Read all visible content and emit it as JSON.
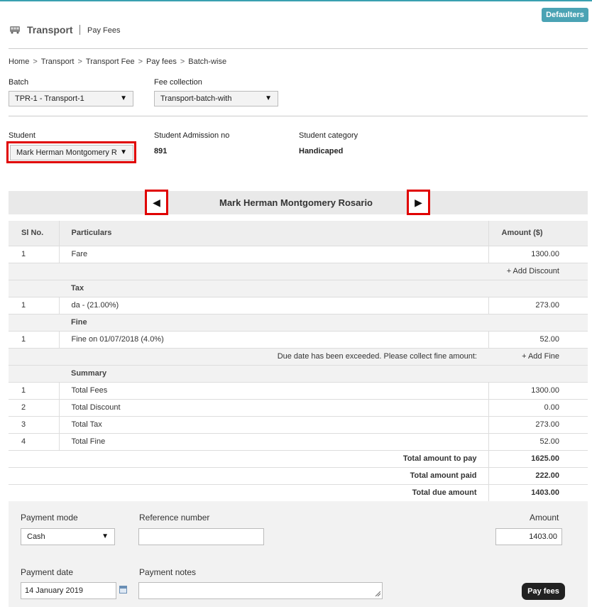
{
  "header": {
    "title": "Transport",
    "subtitle": "Pay Fees",
    "defaulters_label": "Defaulters",
    "icon": "bus-icon"
  },
  "breadcrumb": {
    "items": [
      "Home",
      "Transport",
      "Transport Fee",
      "Pay fees"
    ],
    "current": "Batch-wise",
    "separator": ">"
  },
  "filters": {
    "batch_label": "Batch",
    "batch_value": "TPR-1 - Transport-1",
    "fee_collection_label": "Fee collection",
    "fee_collection_value": "Transport-batch-with"
  },
  "student": {
    "student_label": "Student",
    "student_value": "Mark Herman Montgomery R",
    "admission_label": "Student Admission no",
    "admission_value": "891",
    "category_label": "Student category",
    "category_value": "Handicaped",
    "full_name": "Mark Herman Montgomery Rosario"
  },
  "table": {
    "headers": {
      "sl": "Sl No.",
      "particulars": "Particulars",
      "amount": "Amount ($)"
    },
    "fare_row": {
      "sl": "1",
      "particular": "Fare",
      "amount": "1300.00"
    },
    "add_discount": "+ Add Discount",
    "tax_section": "Tax",
    "tax_row": {
      "sl": "1",
      "particular": "da - (21.00%)",
      "amount": "273.00"
    },
    "fine_section": "Fine",
    "fine_row": {
      "sl": "1",
      "particular": "Fine on 01/07/2018 (4.0%)",
      "amount": "52.00"
    },
    "due_message": "Due date has been exceeded. Please collect fine amount:",
    "add_fine": "+ Add Fine",
    "summary_section": "Summary",
    "summary": [
      {
        "sl": "1",
        "label": "Total Fees",
        "amount": "1300.00"
      },
      {
        "sl": "2",
        "label": "Total Discount",
        "amount": "0.00"
      },
      {
        "sl": "3",
        "label": "Total Tax",
        "amount": "273.00"
      },
      {
        "sl": "4",
        "label": "Total Fine",
        "amount": "52.00"
      }
    ],
    "totals": [
      {
        "label": "Total amount to pay",
        "amount": "1625.00"
      },
      {
        "label": "Total amount paid",
        "amount": "222.00"
      },
      {
        "label": "Total due amount",
        "amount": "1403.00"
      }
    ]
  },
  "payment": {
    "mode_label": "Payment mode",
    "mode_value": "Cash",
    "reference_label": "Reference number",
    "reference_value": "",
    "amount_label": "Amount",
    "amount_value": "1403.00",
    "date_label": "Payment date",
    "date_value": "14 January 2019",
    "notes_label": "Payment notes",
    "notes_value": "",
    "pay_button": "Pay fees"
  },
  "colors": {
    "accent": "#4ba3b4",
    "highlight_box": "#e00000"
  }
}
